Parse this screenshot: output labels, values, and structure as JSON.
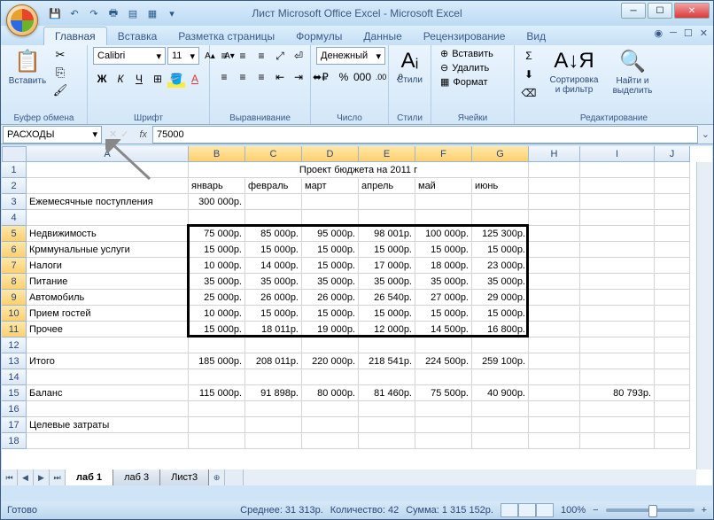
{
  "title": "Лист Microsoft Office Excel - Microsoft Excel",
  "tabs": [
    "Главная",
    "Вставка",
    "Разметка страницы",
    "Формулы",
    "Данные",
    "Рецензирование",
    "Вид"
  ],
  "activeTab": 0,
  "ribbon": {
    "clipboard": {
      "label": "Буфер обмена",
      "paste": "Вставить"
    },
    "font": {
      "label": "Шрифт",
      "name": "Calibri",
      "size": "11"
    },
    "align": {
      "label": "Выравнивание"
    },
    "number": {
      "label": "Число",
      "format": "Денежный"
    },
    "styles": {
      "label": "Стили",
      "btn": "Стили"
    },
    "cells": {
      "label": "Ячейки",
      "insert": "Вставить",
      "delete": "Удалить",
      "format": "Формат"
    },
    "editing": {
      "label": "Редактирование",
      "sort": "Сортировка и фильтр",
      "find": "Найти и выделить"
    }
  },
  "nameBox": "РАСХОДЫ",
  "formula": "75000",
  "columns": [
    "A",
    "B",
    "C",
    "D",
    "E",
    "F",
    "G",
    "H",
    "I",
    "J"
  ],
  "rows": [
    "1",
    "2",
    "3",
    "4",
    "5",
    "6",
    "7",
    "8",
    "9",
    "10",
    "11",
    "12",
    "13",
    "14",
    "15",
    "16",
    "17",
    "18"
  ],
  "sheetTabs": [
    "лаб 1",
    "лаб 3",
    "Лист3"
  ],
  "activeSheet": 0,
  "statusbar": {
    "ready": "Готово",
    "avg": "Среднее: 31 313р.",
    "count": "Количество: 42",
    "sum": "Сумма: 1 315 152р.",
    "zoom": "100%"
  },
  "cells": {
    "title": "Проект бюджета на 2011 г",
    "months": [
      "январь",
      "февраль",
      "март",
      "апрель",
      "май",
      "июнь"
    ],
    "r3a": "Ежемесячные поступления",
    "r3b": "300 000р.",
    "cat": [
      "Недвижимость",
      "Крммунальные услуги",
      "Налоги",
      "Питание",
      "Автомобиль",
      "Прием гостей",
      "Прочее"
    ],
    "data": [
      [
        "75 000р.",
        "85 000р.",
        "95 000р.",
        "98 001р.",
        "100 000р.",
        "125 300р."
      ],
      [
        "15 000р.",
        "15 000р.",
        "15 000р.",
        "15 000р.",
        "15 000р.",
        "15 000р."
      ],
      [
        "10 000р.",
        "14 000р.",
        "15 000р.",
        "17 000р.",
        "18 000р.",
        "23 000р."
      ],
      [
        "35 000р.",
        "35 000р.",
        "35 000р.",
        "35 000р.",
        "35 000р.",
        "35 000р."
      ],
      [
        "25 000р.",
        "26 000р.",
        "26 000р.",
        "26 540р.",
        "27 000р.",
        "29 000р."
      ],
      [
        "10 000р.",
        "15 000р.",
        "15 000р.",
        "15 000р.",
        "15 000р.",
        "15 000р."
      ],
      [
        "15 000р.",
        "18 011р.",
        "19 000р.",
        "12 000р.",
        "14 500р.",
        "16 800р."
      ]
    ],
    "r13a": "Итого",
    "totals": [
      "185 000р.",
      "208 011р.",
      "220 000р.",
      "218 541р.",
      "224 500р.",
      "259 100р."
    ],
    "r15a": "Баланс",
    "balance": [
      "115 000р.",
      "91 898р.",
      "80 000р.",
      "81 460р.",
      "75 500р.",
      "40 900р."
    ],
    "r15i": "80 793р.",
    "r17a": "Целевые затраты"
  }
}
